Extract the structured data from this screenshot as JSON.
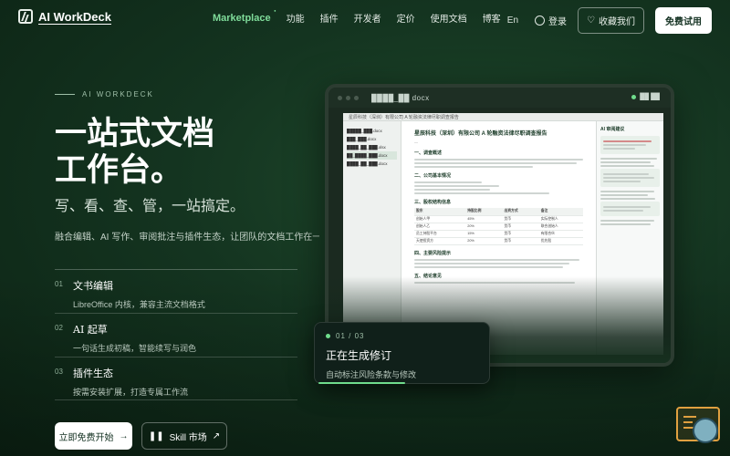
{
  "nav": {
    "logo_text": "AI WorkDeck",
    "links": [
      "Marketplace",
      "功能",
      "插件",
      "开发者",
      "定价",
      "使用文档",
      "博客"
    ],
    "lang": "En",
    "login": "登录",
    "favorite": "收藏我们",
    "primary": "免费试用"
  },
  "hero": {
    "eyebrow": "AI WORKDECK",
    "title_line1": "一站式文档",
    "title_line2": "工作台。",
    "subtitle": "写、看、查、管，一站搞定。",
    "description": "融合编辑、AI 写作、审阅批注与插件生态，让团队的文档工作在一个界面里完成。"
  },
  "features": [
    {
      "num": "01",
      "title": "文书编辑",
      "desc": "LibreOffice 内核，兼容主流文档格式"
    },
    {
      "num": "02",
      "title": "AI 起草",
      "desc": "一句话生成初稿，智能续写与润色"
    },
    {
      "num": "03",
      "title": "插件生态",
      "desc": "按需安装扩展，打造专属工作流"
    }
  ],
  "cta": {
    "primary": "立即免费开始",
    "secondary": "Skill 市场"
  },
  "device": {
    "filename": "████_██ docx",
    "status": "██ ██",
    "doc_title": "星辰科技（深圳）有限公司 A 轮融资法律尽职调查报告",
    "sidebar_files": [
      "█████_███.docx",
      "███_███.docx",
      "████_██_███.xlsx",
      "██_████_███.docx",
      "████_██_███.docx"
    ],
    "sections": [
      "一、调查概述",
      "二、公司基本情况",
      "三、股权结构信息",
      "四、主要风险提示",
      "五、结论意见"
    ],
    "table_rows": [
      [
        "股东",
        "持股比例",
        "出资方式",
        "备注"
      ],
      [
        "创始人甲",
        "45%",
        "货币",
        "实际控制人"
      ],
      [
        "创始人乙",
        "20%",
        "货币",
        "联合创始人"
      ],
      [
        "员工持股平台",
        "15%",
        "货币",
        "有限合伙"
      ],
      [
        "天使投资方",
        "20%",
        "货币",
        "优先股"
      ]
    ],
    "panel_title": "AI 审阅建议"
  },
  "status_card": {
    "step": "01 / 03",
    "title": "正在生成修订",
    "desc": "自动标注风险条款与修改"
  },
  "progress": 0.49
}
